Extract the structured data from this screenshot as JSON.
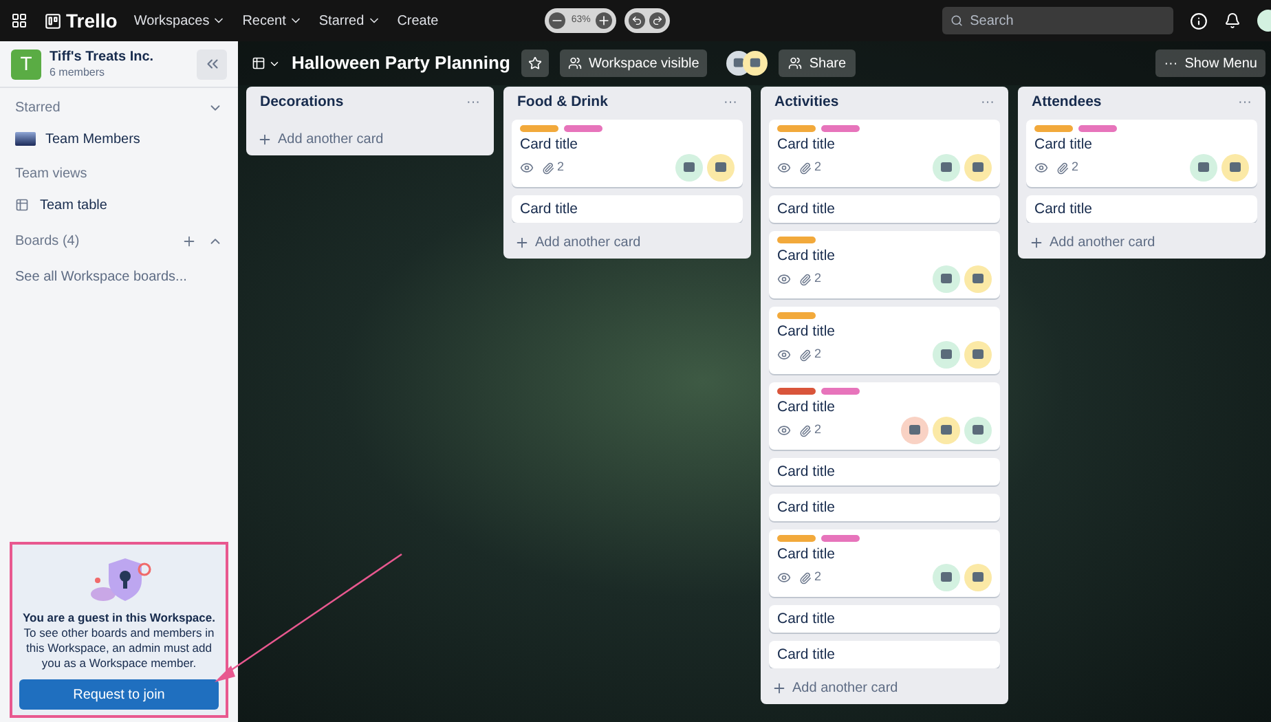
{
  "top_nav": {
    "logo": "Trello",
    "items": [
      {
        "label": "Workspaces",
        "kind": "menu"
      },
      {
        "label": "Recent",
        "kind": "menu"
      },
      {
        "label": "Starred",
        "kind": "menu"
      },
      {
        "label": "Create",
        "kind": "button"
      }
    ],
    "zoom": "63%",
    "search": {
      "placeholder": "Search"
    }
  },
  "sidebar": {
    "workspace": {
      "initial": "T",
      "name": "Tiff's Treats Inc.",
      "members": "6 members"
    },
    "starred": {
      "title": "Starred",
      "items": [
        {
          "label": "Team Members"
        }
      ]
    },
    "views": {
      "title": "Team views",
      "items": [
        {
          "label": "Team table"
        }
      ]
    },
    "boards": {
      "title": "Boards (4)",
      "link": "See all Workspace boards..."
    },
    "guest": {
      "message": "**You are a guest in this Workspace.** To see other boards and members in this Workspace, an admin must add you as a Workspace member.",
      "button": "Request to join"
    }
  },
  "board": {
    "title": "Halloween Party Planning",
    "visibility": "Workspace visible",
    "members": [
      {
        "color": "#d6dde3"
      },
      {
        "color": "#fbe9a6"
      }
    ],
    "share": "Share",
    "menu_icon": "···",
    "menu": "Show Menu"
  },
  "lists": [
    {
      "title": "Decorations",
      "menu": "···",
      "add": "Add another card"
    },
    {
      "title": "Food & Drink",
      "menu": "···",
      "add": "Add another card",
      "cards": [
        {
          "labels": [
            {
              "color": "#f2a93b"
            },
            {
              "color": "#e774bb"
            }
          ],
          "title": "Card title",
          "attachments": "2",
          "avatars": [
            {
              "color": "#d3f1e0"
            },
            {
              "color": "#fbe9a6"
            }
          ]
        },
        {
          "title": "Card title"
        }
      ]
    },
    {
      "title": "Activities",
      "menu": "···",
      "add": "Add another card",
      "cards": [
        {
          "labels": [
            {
              "color": "#f2a93b"
            },
            {
              "color": "#e774bb"
            }
          ],
          "title": "Card title",
          "attachments": "2",
          "avatars": [
            {
              "color": "#d3f1e0"
            },
            {
              "color": "#fbe9a6"
            }
          ]
        },
        {
          "title": "Card title"
        },
        {
          "labels": [
            {
              "color": "#f2a93b"
            }
          ],
          "title": "Card title",
          "attachments": "2",
          "avatars": [
            {
              "color": "#d3f1e0"
            },
            {
              "color": "#fbe9a6"
            }
          ]
        },
        {
          "labels": [
            {
              "color": "#f2a93b"
            }
          ],
          "title": "Card title",
          "attachments": "2",
          "avatars": [
            {
              "color": "#d3f1e0"
            },
            {
              "color": "#fbe9a6"
            }
          ]
        },
        {
          "labels": [
            {
              "color": "#d9553b"
            },
            {
              "color": "#e774bb"
            }
          ],
          "title": "Card title",
          "attachments": "2",
          "avatars": [
            {
              "color": "#f9d2c4"
            },
            {
              "color": "#fbe9a6"
            },
            {
              "color": "#d3f1e0"
            }
          ]
        },
        {
          "title": "Card title"
        },
        {
          "title": "Card title"
        },
        {
          "labels": [
            {
              "color": "#f2a93b"
            },
            {
              "color": "#e774bb"
            }
          ],
          "title": "Card title",
          "attachments": "2",
          "avatars": [
            {
              "color": "#d3f1e0"
            },
            {
              "color": "#fbe9a6"
            }
          ]
        },
        {
          "title": "Card title"
        },
        {
          "title": "Card title"
        }
      ]
    },
    {
      "title": "Attendees",
      "menu": "···",
      "add": "Add another card",
      "cards": [
        {
          "labels": [
            {
              "color": "#f2a93b"
            },
            {
              "color": "#e774bb"
            }
          ],
          "title": "Card title",
          "attachments": "2",
          "avatars": [
            {
              "color": "#d3f1e0"
            },
            {
              "color": "#fbe9a6"
            }
          ]
        },
        {
          "title": "Card title"
        }
      ]
    }
  ]
}
